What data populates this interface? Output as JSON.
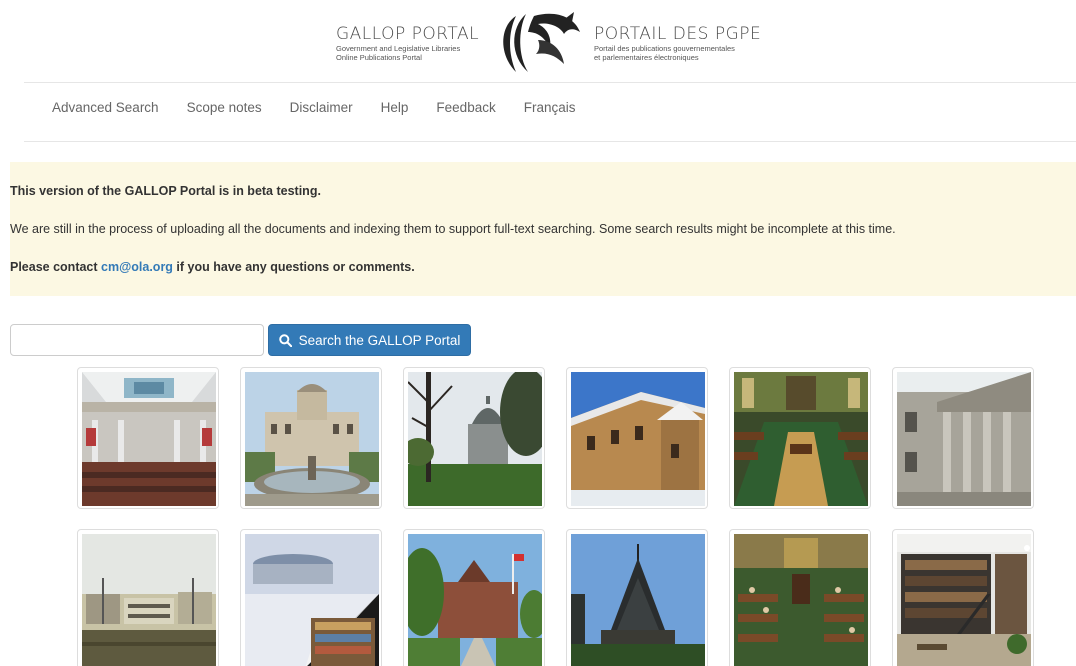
{
  "header": {
    "logo_en_title": "GALLOP PORTAL",
    "logo_en_sub1": "Government and Legislative Libraries",
    "logo_en_sub2": "Online Publications Portal",
    "logo_fr_title": "PORTAIL DES PGPE",
    "logo_fr_sub1": "Portail des publications gouvernementales",
    "logo_fr_sub2": "et parlementaires électroniques"
  },
  "nav": {
    "items": [
      "Advanced Search",
      "Scope notes",
      "Disclaimer",
      "Help",
      "Feedback",
      "Français"
    ]
  },
  "notice": {
    "heading": "This version of the GALLOP Portal is in beta testing.",
    "body": "We are still in the process of uploading all the documents and indexing them to support full-text searching. Some search results might be incomplete at this time.",
    "contact_prefix": "Please contact ",
    "contact_email": "cm@ola.org",
    "contact_suffix": " if you have any questions or comments."
  },
  "search": {
    "value": "",
    "button_label": "Search the GALLOP Portal",
    "button_icon": "search-icon"
  },
  "colors": {
    "notice_bg": "#fcf8e3",
    "primary": "#337ab7",
    "link": "#337ab7",
    "nav_text": "#666666"
  },
  "gallery": {
    "rows": 2,
    "per_row": 6,
    "subjects": [
      "chamber-with-skylight",
      "building-with-fountain",
      "dome-behind-trees",
      "stone-building-in-snow",
      "green-chamber",
      "columned-facade",
      "modern-buildings-under-sky",
      "page-curl-library",
      "red-stone-legislature",
      "gothic-library-spire",
      "chamber-with-members",
      "library-interior-shelves"
    ]
  }
}
